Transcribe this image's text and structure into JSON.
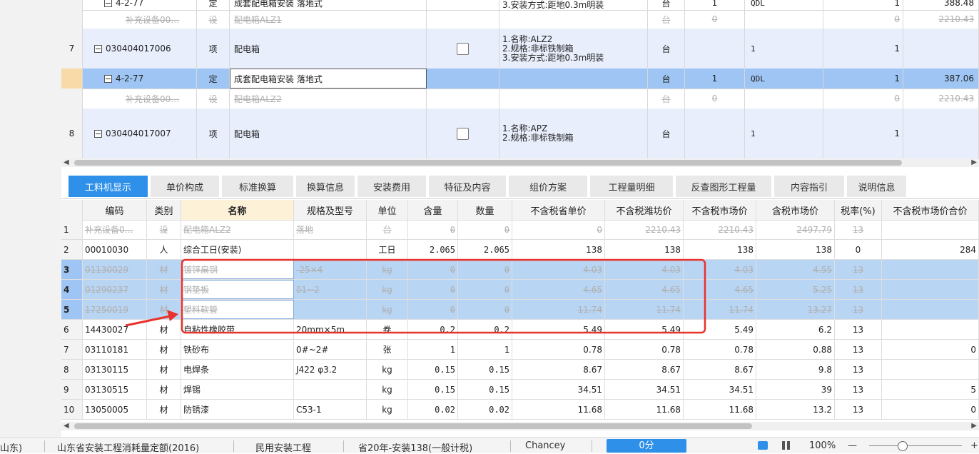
{
  "upper_grid": {
    "rows": [
      {
        "no": "",
        "code": "4-2-77",
        "type": "定",
        "name": "成套配电箱安装 落地式",
        "feature": "3.安装方式:距地0.3m明装",
        "unit": "台",
        "qty_expr": "1",
        "qty": "QDL",
        "count": "1",
        "price": "388.48",
        "style": "child"
      },
      {
        "no": "",
        "code": "补充设备00…",
        "type": "设",
        "name": "配电箱ALZ1",
        "feature": "",
        "unit": "台",
        "qty_expr": "0",
        "qty": "",
        "count": "0",
        "price": "2210.43",
        "style": "grayed"
      },
      {
        "no": "7",
        "code": "030404017006",
        "type": "项",
        "name": "配电箱",
        "feature": "1.名称:ALZ2\n2.规格:非标铁制箱\n3.安装方式:距地0.3m明装",
        "unit": "台",
        "qty_expr": "",
        "qty": "1",
        "count": "1",
        "price": "",
        "style": "item"
      },
      {
        "no": "",
        "code": "4-2-77",
        "type": "定",
        "name": "成套配电箱安装 落地式",
        "feature": "",
        "unit": "台",
        "qty_expr": "1",
        "qty": "QDL",
        "count": "1",
        "price": "387.06",
        "style": "current"
      },
      {
        "no": "",
        "code": "补充设备00…",
        "type": "设",
        "name": "配电箱ALZ2",
        "feature": "",
        "unit": "台",
        "qty_expr": "0",
        "qty": "",
        "count": "0",
        "price": "2210.43",
        "style": "grayed"
      },
      {
        "no": "8",
        "code": "030404017007",
        "type": "项",
        "name": "配电箱",
        "feature": "1.名称:APZ\n2.规格:非标铁制箱",
        "unit": "台",
        "qty_expr": "",
        "qty": "1",
        "count": "1",
        "price": "",
        "style": "item"
      }
    ]
  },
  "tabs": [
    "工料机显示",
    "单价构成",
    "标准换算",
    "换算信息",
    "安装费用",
    "特征及内容",
    "组价方案",
    "工程量明细",
    "反查图形工程量",
    "内容指引",
    "说明信息"
  ],
  "lower_grid": {
    "headers": [
      "编码",
      "类别",
      "名称",
      "规格及型号",
      "单位",
      "含量",
      "数量",
      "不含税省单价",
      "不含税潍坊价",
      "不含税市场价",
      "含税市场价",
      "税率(%)",
      "不含税市场价合价"
    ],
    "rows": [
      {
        "no": "1",
        "cells": [
          "补充设备0…",
          "设",
          "配电箱ALZ2",
          "落地",
          "台",
          "0",
          "0",
          "0",
          "2210.43",
          "2210.43",
          "2497.79",
          "13",
          ""
        ],
        "style": "grayed"
      },
      {
        "no": "2",
        "cells": [
          "00010030",
          "人",
          "综合工日(安装)",
          "",
          "工日",
          "2.065",
          "2.065",
          "138",
          "138",
          "138",
          "138",
          "0",
          "284"
        ],
        "style": "normal"
      },
      {
        "no": "3",
        "cells": [
          "01130029",
          "材",
          "镀锌扁钢",
          "-25×4",
          "kg",
          "0",
          "0",
          "4.03",
          "4.03",
          "4.03",
          "4.55",
          "13",
          ""
        ],
        "style": "hl"
      },
      {
        "no": "4",
        "cells": [
          "01290237",
          "材",
          "钢垫板",
          "δ1~2",
          "kg",
          "0",
          "0",
          "4.65",
          "4.65",
          "4.65",
          "5.25",
          "13",
          ""
        ],
        "style": "hl"
      },
      {
        "no": "5",
        "cells": [
          "17250019",
          "材",
          "塑料软管",
          "",
          "kg",
          "0",
          "0",
          "11.74",
          "11.74",
          "11.74",
          "13.27",
          "13",
          ""
        ],
        "style": "hl"
      },
      {
        "no": "6",
        "cells": [
          "14430027",
          "材",
          "自粘性橡胶带",
          "20mm×5m",
          "卷",
          "0.2",
          "0.2",
          "5.49",
          "5.49",
          "5.49",
          "6.2",
          "13",
          ""
        ],
        "style": "normal"
      },
      {
        "no": "7",
        "cells": [
          "03110181",
          "材",
          "铁砂布",
          "0#~2#",
          "张",
          "1",
          "1",
          "0.78",
          "0.78",
          "0.78",
          "0.88",
          "13",
          "0"
        ],
        "style": "normal"
      },
      {
        "no": "8",
        "cells": [
          "03130115",
          "材",
          "电焊条",
          "J422 φ3.2",
          "kg",
          "0.15",
          "0.15",
          "8.67",
          "8.67",
          "8.67",
          "9.8",
          "13",
          ""
        ],
        "style": "normal"
      },
      {
        "no": "9",
        "cells": [
          "03130515",
          "材",
          "焊锡",
          "",
          "kg",
          "0.15",
          "0.15",
          "34.51",
          "34.51",
          "34.51",
          "39",
          "13",
          "5"
        ],
        "style": "normal"
      },
      {
        "no": "10",
        "cells": [
          "13050005",
          "材",
          "防锈漆",
          "C53-1",
          "kg",
          "0.02",
          "0.02",
          "11.68",
          "11.68",
          "11.68",
          "13.2",
          "13",
          "0"
        ],
        "style": "normal"
      }
    ]
  },
  "status_bar": {
    "region": "山东)",
    "norm": "山东省安装工程消耗量定额(2016)",
    "category": "民用安装工程",
    "price_file": "省20年-安装138(一般计税)",
    "user": "Chancey",
    "score_button": "0分",
    "zoom": "100%",
    "zoom_minus": "—",
    "zoom_plus": "+"
  },
  "colors": {
    "tab_active": "#2e90e8",
    "highlight_row": "#b9d5f4",
    "annotation_red": "#e8322c",
    "current_row": "#9ec5f3"
  }
}
